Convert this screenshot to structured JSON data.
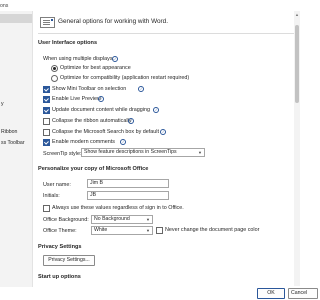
{
  "window": {
    "title": "ons"
  },
  "sidebar": {
    "items": [
      {
        "label": ""
      },
      {
        "label": ""
      },
      {
        "label": ""
      },
      {
        "label": ""
      },
      {
        "label": "y"
      },
      {
        "label": ""
      },
      {
        "label": ""
      },
      {
        "label": "Ribbon"
      },
      {
        "label": "ss Toolbar"
      }
    ]
  },
  "header": {
    "text": "General options for working with Word."
  },
  "ui_options": {
    "heading": "User Interface options",
    "multi_display_label": "When using multiple displays:",
    "radio_best": "Optimize for best appearance",
    "radio_compat": "Optimize for compatibility (application restart required)",
    "checkboxes": [
      {
        "label": "Show Mini Toolbar on selection",
        "checked": true
      },
      {
        "label": "Enable Live Preview",
        "checked": true
      },
      {
        "label": "Update document content while dragging",
        "checked": true
      },
      {
        "label": "Collapse the ribbon automatically",
        "checked": false
      },
      {
        "label": "Collapse the Microsoft Search box by default",
        "checked": false
      },
      {
        "label": "Enable modern comments",
        "checked": true
      }
    ],
    "screentip_label": "ScreenTip style:",
    "screentip_value": "Show feature descriptions in ScreenTips"
  },
  "personalize": {
    "heading": "Personalize your copy of Microsoft Office",
    "username_label": "User name:",
    "username_value": "Jim B",
    "initials_label": "Initials:",
    "initials_value": "JB",
    "always_use_label": "Always use these values regardless of sign in to Office.",
    "background_label": "Office Background:",
    "background_value": "No Background",
    "theme_label": "Office Theme:",
    "theme_value": "White",
    "never_change_label": "Never change the document page color"
  },
  "privacy": {
    "heading": "Privacy Settings",
    "button": "Privacy Settings..."
  },
  "startup": {
    "heading": "Start up options"
  },
  "footer": {
    "ok": "OK",
    "cancel": "Cancel"
  }
}
